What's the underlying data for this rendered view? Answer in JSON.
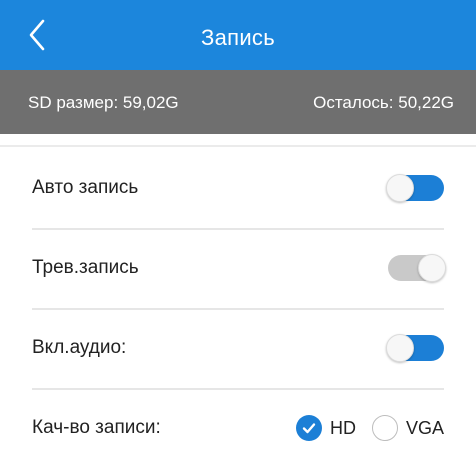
{
  "header": {
    "title": "Запись"
  },
  "info": {
    "sd_size": "SD размер: 59,02G",
    "remaining": "Осталось: 50,22G"
  },
  "settings": [
    {
      "label": "Авто запись",
      "state": "on"
    },
    {
      "label": "Трев.запись",
      "state": "off"
    },
    {
      "label": "Вкл.аудио:",
      "state": "on"
    }
  ],
  "quality": {
    "label": "Кач-во записи:",
    "options": [
      {
        "label": "HD",
        "selected": true
      },
      {
        "label": "VGA",
        "selected": false
      }
    ]
  },
  "colors": {
    "accent": "#1c7fd6",
    "header_bg": "#1c86dc",
    "info_bg": "#6f6f6f"
  }
}
